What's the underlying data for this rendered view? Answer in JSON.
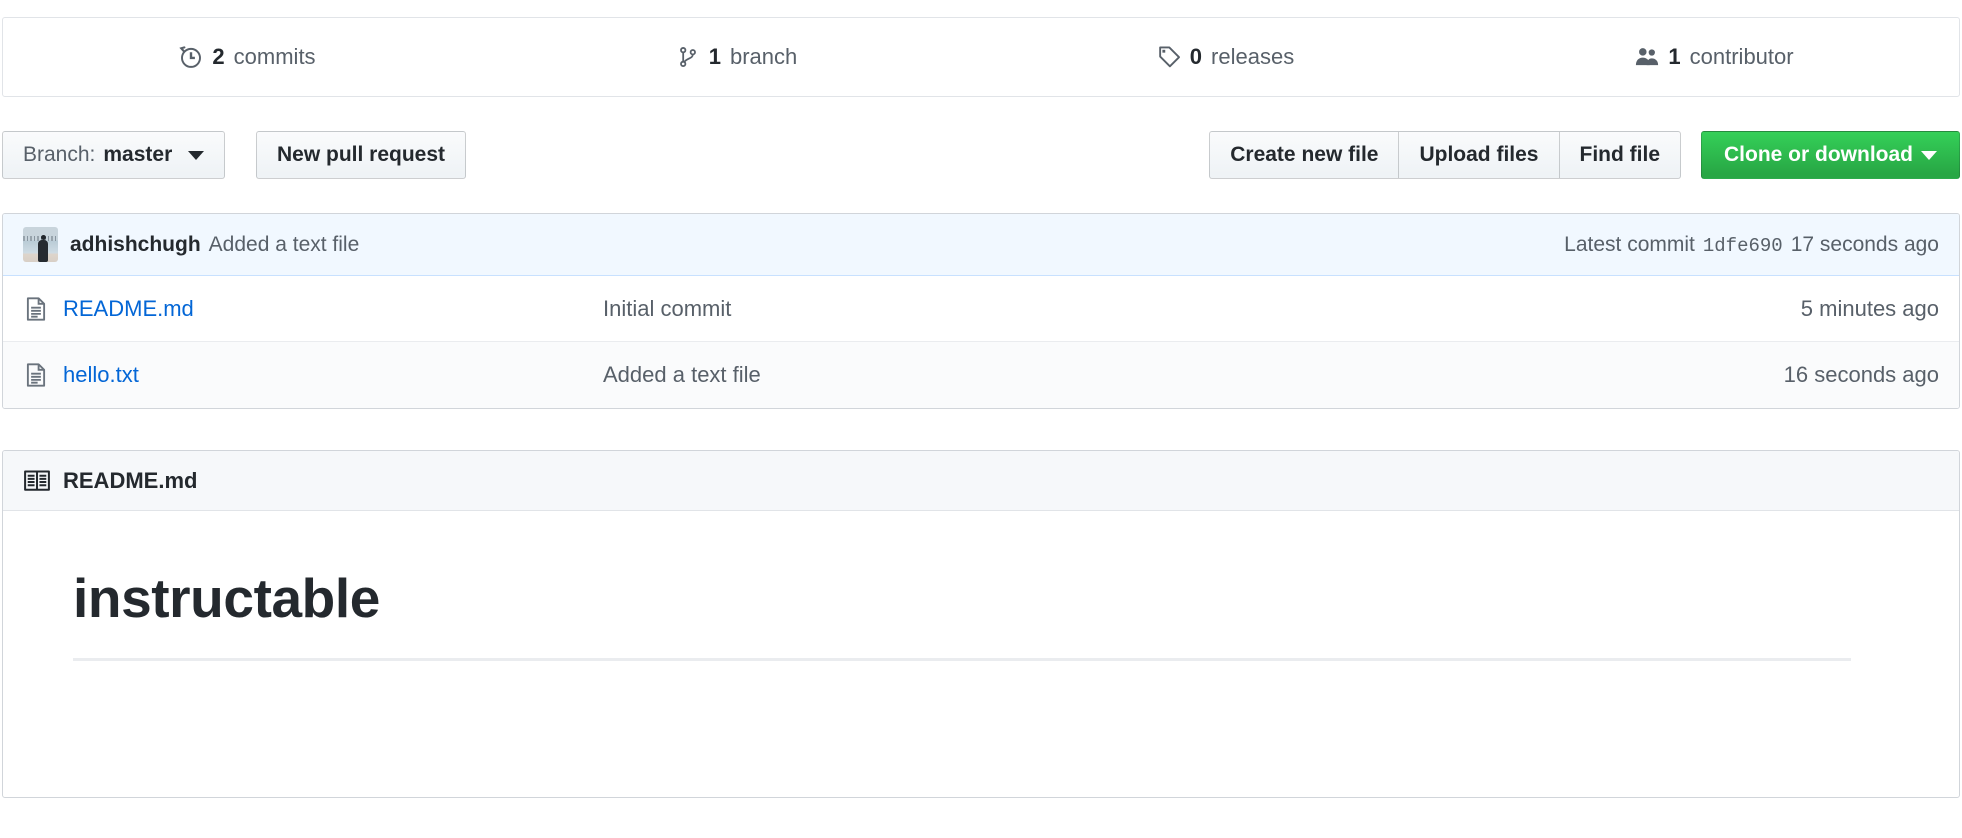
{
  "stats": [
    {
      "icon": "history-icon",
      "num": "2",
      "label": "commits",
      "name": "stat-commits"
    },
    {
      "icon": "git-branch-icon",
      "num": "1",
      "label": "branch",
      "name": "stat-branches"
    },
    {
      "icon": "tag-icon",
      "num": "0",
      "label": "releases",
      "name": "stat-releases"
    },
    {
      "icon": "people-icon",
      "num": "1",
      "label": "contributor",
      "name": "stat-contributors"
    }
  ],
  "toolbar": {
    "branch_prefix": "Branch:",
    "branch_value": "master",
    "new_pull_request": "New pull request",
    "create_new_file": "Create new file",
    "upload_files": "Upload files",
    "find_file": "Find file",
    "clone_or_download": "Clone or download"
  },
  "latest_commit": {
    "author": "adhishchugh",
    "message": "Added a text file",
    "prefix": "Latest commit",
    "sha": "1dfe690",
    "age": "17 seconds ago"
  },
  "files": [
    {
      "icon": "file-icon",
      "name": "README.md",
      "message": "Initial commit",
      "age": "5 minutes ago"
    },
    {
      "icon": "file-icon",
      "name": "hello.txt",
      "message": "Added a text file",
      "age": "16 seconds ago"
    }
  ],
  "readme": {
    "icon": "book-icon",
    "title": "README.md",
    "heading": "instructable"
  },
  "colors": {
    "link": "#0366d6",
    "text": "#24292e",
    "muted": "#586069",
    "green": "#28a745",
    "commit_row_bg": "#f1f8ff",
    "alt_row_bg": "#fafbfc",
    "border": "#d1d5da"
  }
}
